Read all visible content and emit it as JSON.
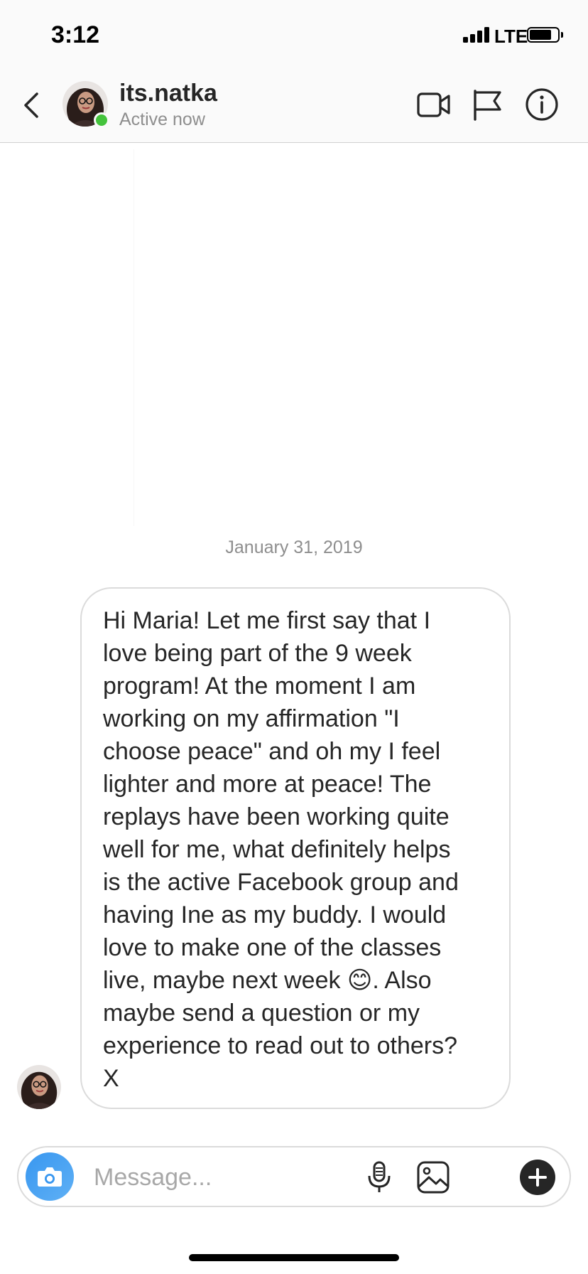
{
  "status_bar": {
    "time": "3:12",
    "network": "LTE",
    "battery_level": 0.8
  },
  "header": {
    "contact_name": "its.natka",
    "contact_status": "Active now",
    "icons": [
      "back-chevron-icon",
      "video-camera-icon",
      "flag-icon",
      "info-icon"
    ],
    "active_color": "#44c33c"
  },
  "conversation": {
    "date": "January 31, 2019",
    "message": "Hi Maria! Let me first say that I\nlove being part of the 9 week\nprogram! At the moment I am\nworking on my affirmation \"I\nchoose peace\" and oh my I feel\nlighter and more at peace! The\nreplays have been working quite\nwell for me, what definitely helps\nis the active Facebook group and\nhaving Ine as my buddy. I would\nlove to make one of the classes\nlive, maybe next week 😊. Also\nmaybe send a question or my\nexperience to read out to others?\nX"
  },
  "composer": {
    "placeholder": "Message...",
    "icons": [
      "camera-icon",
      "microphone-icon",
      "gallery-icon",
      "plus-icon"
    ],
    "camera_color": "#3897f0"
  }
}
